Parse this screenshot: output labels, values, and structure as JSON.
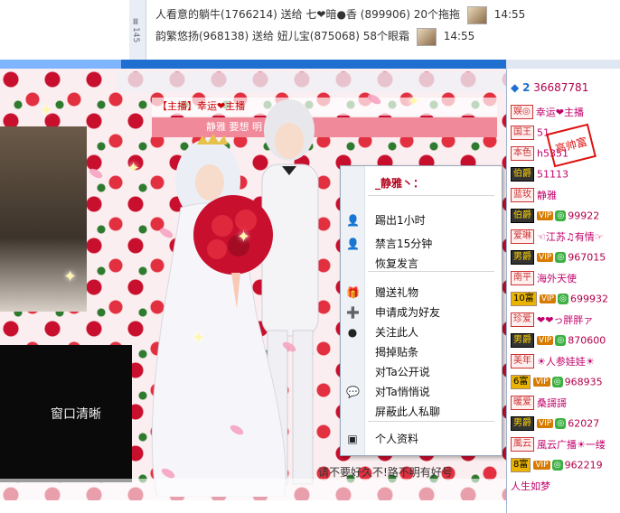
{
  "ticker": {
    "side_label": "Ⅲ145",
    "rows": [
      {
        "text": "人看意的躺牛(1766214) 送给 七❤暗●香 (899906) 20个拖拖",
        "time": "14:55"
      },
      {
        "text": "韵繁悠扬(968138) 送给 妞儿宝(875068) 58个眼霜",
        "time": "14:55"
      }
    ]
  },
  "progress": {
    "fraction": 0.24
  },
  "room": {
    "tab_label": "【主播】幸运❤主播",
    "sub_label": "静雅 要想 明 字"
  },
  "chat_panel": {
    "label": "窗口清晰"
  },
  "bottom": {
    "text": "请不要好久不!路不明有好号"
  },
  "menu": {
    "title": "_静雅丶：",
    "items": [
      {
        "label": "踢出1小时",
        "icon": "user-kick-icon",
        "glyph": "👤"
      },
      {
        "label": "禁言15分钟",
        "icon": "user-mute-icon",
        "glyph": "👤"
      },
      {
        "label": "恢复发言",
        "icon": "",
        "glyph": ""
      },
      {
        "label": "赠送礼物",
        "icon": "gift-icon",
        "glyph": "🎁"
      },
      {
        "label": "申请成为好友",
        "icon": "add-friend-icon",
        "glyph": "➕"
      },
      {
        "label": "关注此人",
        "icon": "follow-icon",
        "glyph": "●"
      },
      {
        "label": "揭掉贴条",
        "icon": "",
        "glyph": ""
      },
      {
        "label": "对Ta公开说",
        "icon": "",
        "glyph": ""
      },
      {
        "label": "对Ta悄悄说",
        "icon": "chat-bubble-icon",
        "glyph": "💬"
      },
      {
        "label": "屏蔽此人私聊",
        "icon": "",
        "glyph": ""
      },
      {
        "label": "个人资料",
        "icon": "profile-card-icon",
        "glyph": "▣"
      }
    ]
  },
  "userlist": {
    "header_num": "2",
    "header_id": "36687781",
    "rows": [
      {
        "badge": "娱◎",
        "badge_style": "",
        "vip": "",
        "coin": "",
        "name": "幸运❤主播"
      },
      {
        "badge": "国王",
        "badge_style": "",
        "vip": "",
        "coin": "",
        "name": "51"
      },
      {
        "badge": "本色",
        "badge_style": "",
        "vip": "",
        "coin": "",
        "name": "h5351"
      },
      {
        "badge": "伯爵",
        "badge_style": "dark",
        "vip": "",
        "coin": "",
        "name": "51113"
      },
      {
        "badge": "蓝玫",
        "badge_style": "",
        "vip": "",
        "coin": "",
        "name": "静雅"
      },
      {
        "badge": "伯爵",
        "badge_style": "dark",
        "vip": "VIP",
        "coin": "◎",
        "name": "99922"
      },
      {
        "badge": "爱琳",
        "badge_style": "",
        "vip": "",
        "coin": "",
        "name": "☜江苏♫有情☞"
      },
      {
        "badge": "男爵",
        "badge_style": "dark",
        "vip": "VIP",
        "coin": "◎",
        "name": "967015"
      },
      {
        "badge": "南平",
        "badge_style": "",
        "vip": "",
        "coin": "",
        "name": "海外天使"
      },
      {
        "badge": "10富",
        "badge_style": "gold",
        "vip": "VIP",
        "coin": "◎",
        "name": "699932"
      },
      {
        "badge": "珍爱",
        "badge_style": "",
        "vip": "",
        "coin": "",
        "name": "❤❤っ胖胖ァ"
      },
      {
        "badge": "男爵",
        "badge_style": "dark",
        "vip": "VIP",
        "coin": "◎",
        "name": "870600"
      },
      {
        "badge": "美年",
        "badge_style": "",
        "vip": "",
        "coin": "",
        "name": "☀人参娃娃☀"
      },
      {
        "badge": "6富",
        "badge_style": "gold",
        "vip": "VIP",
        "coin": "◎",
        "name": "968935"
      },
      {
        "badge": "暖爱",
        "badge_style": "",
        "vip": "",
        "coin": "",
        "name": "桑謌謌"
      },
      {
        "badge": "男爵",
        "badge_style": "dark",
        "vip": "VIP",
        "coin": "◎",
        "name": "62027"
      },
      {
        "badge": "風云",
        "badge_style": "",
        "vip": "",
        "coin": "",
        "name": "風云广播☀一缕"
      },
      {
        "badge": "8富",
        "badge_style": "gold",
        "vip": "VIP",
        "coin": "◎",
        "name": "962219"
      },
      {
        "badge": "",
        "badge_style": "",
        "vip": "",
        "coin": "",
        "name": "人生如梦"
      }
    ]
  },
  "stamp": {
    "text": "高帅富"
  },
  "colors": {
    "accent": "#1f6fd0",
    "menu_title": "#b3001b",
    "rose": "#c8102e"
  }
}
